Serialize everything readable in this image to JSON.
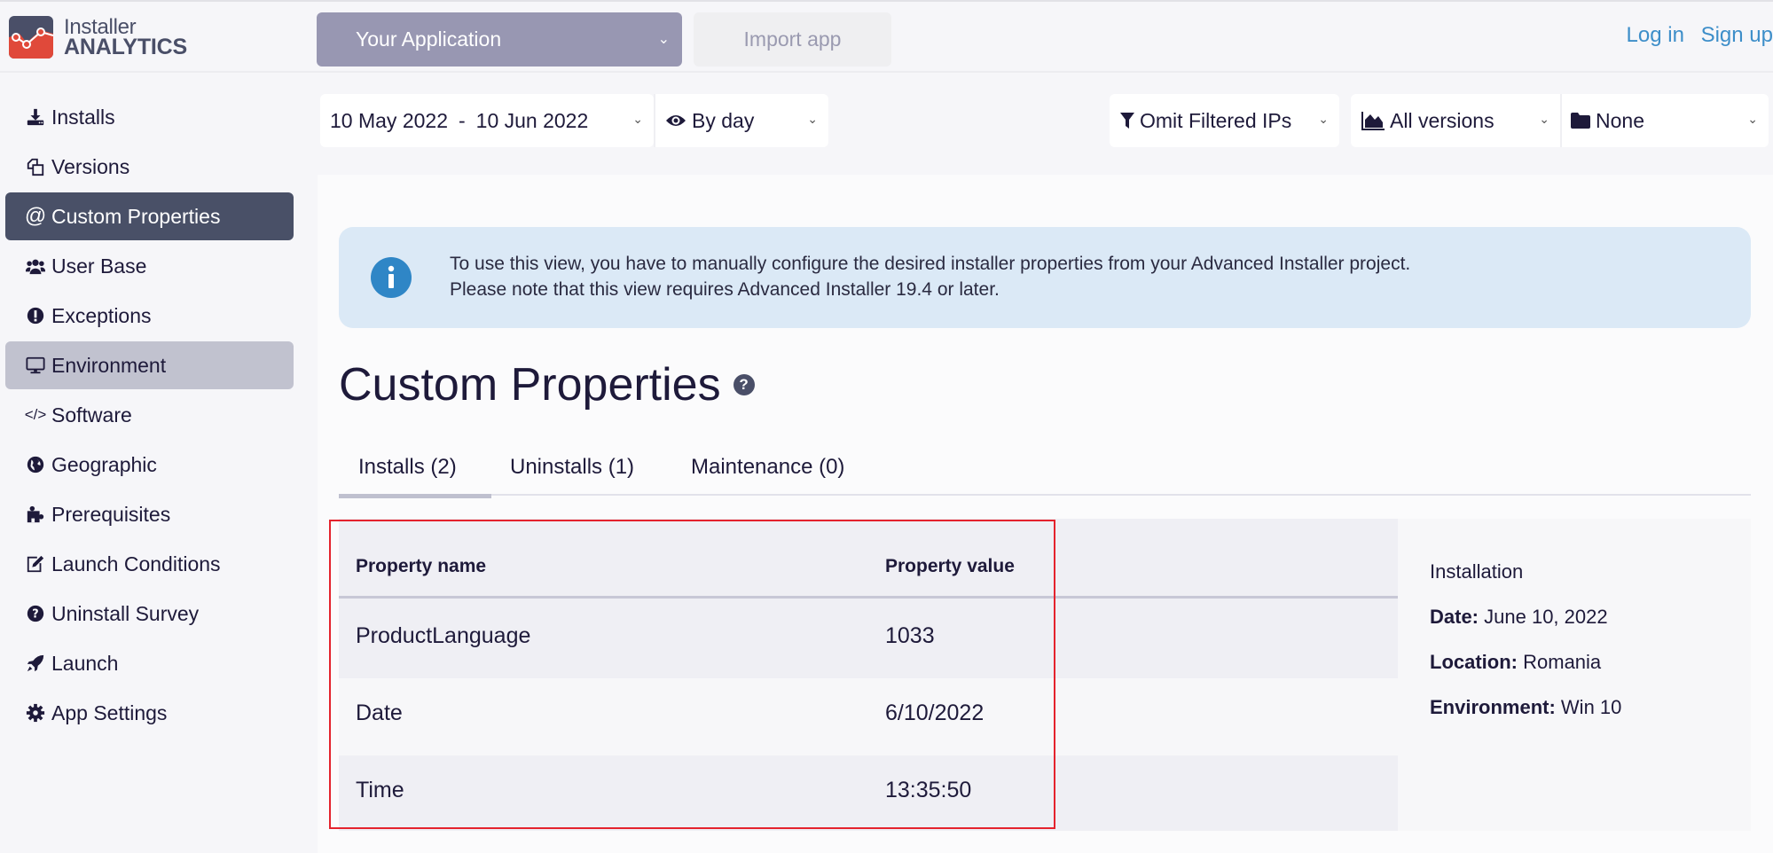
{
  "header": {
    "logo": {
      "line1": "Installer",
      "line2": "ANALYTICS"
    },
    "app_select": {
      "value": "Your Application"
    },
    "import_button": "Import app",
    "login": "Log in",
    "signup": "Sign up"
  },
  "sidebar": {
    "items": [
      {
        "label": "Installs",
        "icon": "download-icon"
      },
      {
        "label": "Versions",
        "icon": "copy-icon"
      },
      {
        "label": "Custom Properties",
        "icon": "at-icon",
        "active": true
      },
      {
        "label": "User Base",
        "icon": "users-icon"
      },
      {
        "label": "Exceptions",
        "icon": "exclamation-circle-icon"
      },
      {
        "label": "Environment",
        "icon": "monitor-icon",
        "hover": true
      },
      {
        "label": "Software",
        "icon": "code-icon"
      },
      {
        "label": "Geographic",
        "icon": "globe-icon"
      },
      {
        "label": "Prerequisites",
        "icon": "puzzle-icon"
      },
      {
        "label": "Launch Conditions",
        "icon": "edit-icon"
      },
      {
        "label": "Uninstall Survey",
        "icon": "question-circle-icon"
      },
      {
        "label": "Launch",
        "icon": "rocket-icon"
      },
      {
        "label": "App Settings",
        "icon": "gear-icon"
      }
    ]
  },
  "filters": {
    "date_range": {
      "from": "10 May 2022",
      "separator": "-",
      "to": "10 Jun 2022"
    },
    "granularity": "By day",
    "ip_filter": "Omit Filtered IPs",
    "versions": "All versions",
    "folder": "None"
  },
  "info": {
    "line1": "To use this view, you have to manually configure the desired installer properties from your Advanced Installer project.",
    "line2": "Please note that this view requires Advanced Installer 19.4 or later."
  },
  "page": {
    "title": "Custom Properties",
    "help": "?"
  },
  "tabs": [
    {
      "label": "Installs (2)",
      "active": true
    },
    {
      "label": "Uninstalls (1)"
    },
    {
      "label": "Maintenance (0)"
    }
  ],
  "table": {
    "columns": [
      "Property name",
      "Property value"
    ],
    "rows": [
      {
        "name": "ProductLanguage",
        "value": "1033"
      },
      {
        "name": "Date",
        "value": "6/10/2022"
      },
      {
        "name": "Time",
        "value": "13:35:50"
      }
    ]
  },
  "details": {
    "title": "Installation",
    "date_label": "Date:",
    "date_value": "June 10, 2022",
    "location_label": "Location:",
    "location_value": "Romania",
    "environment_label": "Environment:",
    "environment_value": "Win 10"
  },
  "colors": {
    "accent": "#495067",
    "link": "#3d8ec9",
    "info_bg": "#dbe9f6",
    "info_icon": "#2f86c6",
    "highlight_box": "#e4232d",
    "app_select_bg": "#9897b2"
  }
}
